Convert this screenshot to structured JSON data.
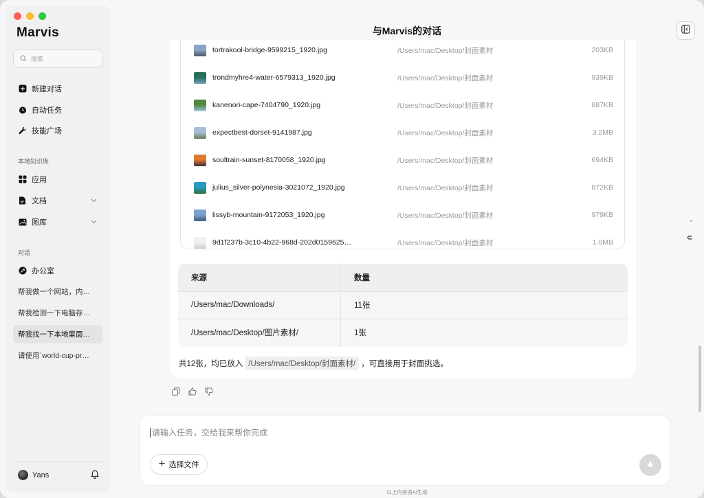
{
  "app": {
    "name": "Marvis",
    "title": "与Marvis的对话"
  },
  "sidebar": {
    "search_placeholder": "搜索",
    "main_nav": [
      {
        "label": "新建对话",
        "icon": "new-chat-icon"
      },
      {
        "label": "自动任务",
        "icon": "clock-icon"
      },
      {
        "label": "技能广场",
        "icon": "wrench-icon"
      }
    ],
    "knowledge_title": "本地知识库",
    "knowledge_nav": [
      {
        "label": "应用",
        "icon": "apps-grid-icon"
      },
      {
        "label": "文档",
        "icon": "document-icon"
      },
      {
        "label": "图库",
        "icon": "image-icon"
      }
    ],
    "conversations_title": "对话",
    "office": {
      "label": "办公室",
      "icon": "office-icon"
    },
    "conversations": [
      {
        "label": "帮我做一个网站，内…",
        "active": false
      },
      {
        "label": "帮我检测一下电脑存…",
        "active": false
      },
      {
        "label": "帮我找一下本地里面…",
        "active": true
      },
      {
        "label": "请使用`world-cup-pr…",
        "active": false
      }
    ],
    "user": {
      "name": "Yans"
    }
  },
  "files": [
    {
      "name": "tortrakool-bridge-9599215_1920.jpg",
      "path": "/Users/mac/Desktop/封面素材",
      "size": "203KB",
      "thumb_colors": [
        "#8aa5c4",
        "#4a5a6a"
      ]
    },
    {
      "name": "trondmyhre4-water-6579313_1920.jpg",
      "path": "/Users/mac/Desktop/封面素材",
      "size": "939KB",
      "thumb_colors": [
        "#2a6f5e",
        "#6fa0b8"
      ]
    },
    {
      "name": "kanenori-cape-7404790_1920.jpg",
      "path": "/Users/mac/Desktop/封面素材",
      "size": "887KB",
      "thumb_colors": [
        "#4f8a3c",
        "#9cc2e0"
      ]
    },
    {
      "name": "expectbest-dorset-9141987.jpg",
      "path": "/Users/mac/Desktop/封面素材",
      "size": "3.2MB",
      "thumb_colors": [
        "#a8c0d6",
        "#6d7a55"
      ]
    },
    {
      "name": "soultrain-sunset-8170058_1920.jpg",
      "path": "/Users/mac/Desktop/封面素材",
      "size": "694KB",
      "thumb_colors": [
        "#e07a2e",
        "#3a2a40"
      ]
    },
    {
      "name": "julius_silver-polynesia-3021072_1920.jpg",
      "path": "/Users/mac/Desktop/封面素材",
      "size": "872KB",
      "thumb_colors": [
        "#2a9bc0",
        "#2f6a3a"
      ]
    },
    {
      "name": "lissyb-mountain-9172053_1920.jpg",
      "path": "/Users/mac/Desktop/封面素材",
      "size": "979KB",
      "thumb_colors": [
        "#7ea1cf",
        "#3e5a7a"
      ]
    },
    {
      "name": "9d1f237b-3c10-4b22-968d-202d0159625…",
      "path": "/Users/mac/Desktop/封面素材",
      "size": "1.0MB",
      "thumb_colors": [
        "#f0f0f0",
        "#cfcfcf"
      ]
    }
  ],
  "table": {
    "headers": [
      "来源",
      "数量"
    ],
    "rows": [
      [
        "/Users/mac/Downloads/",
        "11张"
      ],
      [
        "/Users/mac/Desktop/图片素材/",
        "1张"
      ]
    ]
  },
  "summary": {
    "prefix": "共12张，均已放入",
    "path": "/Users/mac/Desktop/封面素材/",
    "suffix": "，可直接用于封面挑选。"
  },
  "composer": {
    "placeholder": "请输入任务，交给我来帮你完成",
    "attach_label": "选择文件"
  },
  "disclaimer": "以上内容由AI生成"
}
